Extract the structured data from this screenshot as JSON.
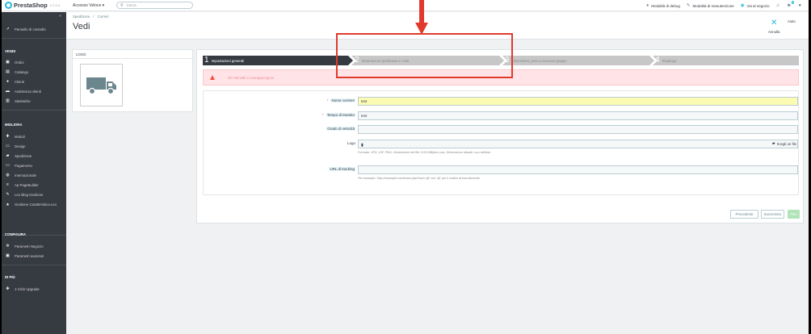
{
  "topbar": {
    "brand": "PrestaShop",
    "version": "1.7.4.4",
    "quick_access": "Accesso Veloce ▾",
    "search_placeholder": "Cerca",
    "debug_mode": "Modalità di debug",
    "maintenance_mode": "Modalità di manutenzione",
    "view_shop": "Vai al negozio",
    "cart_badge": "5"
  },
  "sidebar": {
    "dashboard": "Pannello di controllo",
    "sell_heading": "VENDI",
    "sell_items": [
      "Ordini",
      "Catalogo",
      "Clienti",
      "Assistenza clienti",
      "Statistiche"
    ],
    "improve_heading": "MIGLIORA",
    "improve_items": [
      "Moduli",
      "Design",
      "Spedizione",
      "Pagamento",
      "Internazionale",
      "Ap PageBuilder",
      "Leo Blog Gestione",
      "Gestione Caratteristica Leo"
    ],
    "configure_heading": "CONFIGURA",
    "configure_items": [
      "Parametri Negozio",
      "Parametri avanzati"
    ],
    "more_heading": "DI PIÙ",
    "more_items": [
      "1-Click Upgrade"
    ]
  },
  "header": {
    "breadcrumb": [
      "Spedizione",
      "Corrieri"
    ],
    "title": "Vedi",
    "cancel_label": "Annulla",
    "help_label": "Aiuto"
  },
  "logo_panel": {
    "label": "LOGO"
  },
  "wizard": {
    "steps": [
      {
        "num": "1",
        "label": "Impostazioni generali"
      },
      {
        "num": "2",
        "label": "Destinazioni spedizione e costi"
      },
      {
        "num": "3",
        "label": "Dimensioni, peso e accesso gruppo"
      },
      {
        "num": "4",
        "label": "Riepilogo"
      }
    ],
    "alert": "Gli intervalli si sovrappongono",
    "fields": {
      "carrier_name_label": "Nome corriere",
      "carrier_name_value": "test",
      "transit_time_label": "Tempo di transito",
      "transit_time_value": "test",
      "speed_grade_label": "Grado di velocità",
      "speed_grade_value": "",
      "logo_label": "Logo",
      "logo_button": "Scegli un file",
      "logo_help": "Formato: JPG, GIF, PNG. Dimensione del file: 8.00 MBytes max. Dimensione attuale: non definito.",
      "tracking_label": "URL di tracking",
      "tracking_value": "",
      "tracking_help": "Per esempio: 'http://example.com/track.php?num=@' con '@' per il codice di tracciamento."
    },
    "buttons": {
      "previous": "Precedente",
      "next": "Successivo",
      "finish": "Fine"
    }
  },
  "colors": {
    "brand": "#25b9d7",
    "sidebar_bg": "#363a41",
    "annotation": "#e03a2d",
    "alert_bg": "#ffe3e6"
  }
}
